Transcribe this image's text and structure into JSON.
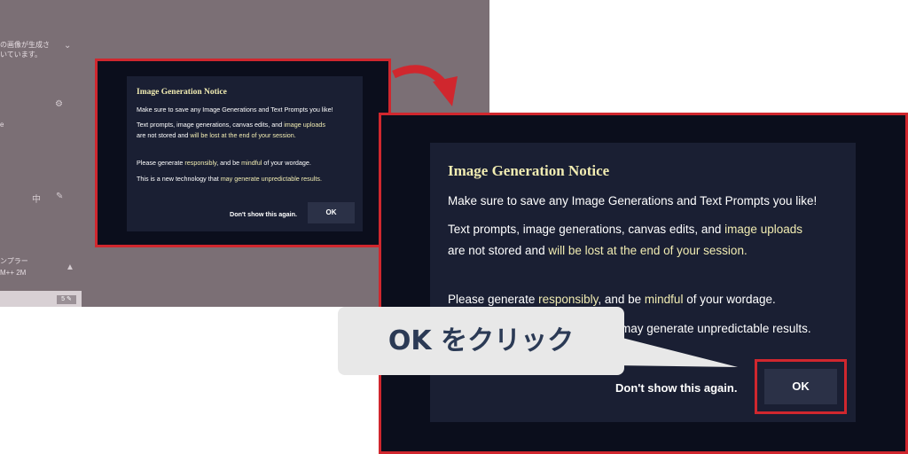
{
  "background_app": {
    "jp_text_line1": "の画像が生成さ",
    "jp_text_line2": "いています。",
    "sidebar_label": "e",
    "history_label": "ンプラー",
    "history_meta": "M++ 2M",
    "counter": "5 ✎"
  },
  "notice_small": {
    "title": "Image Generation Notice",
    "line1": "Make sure to save any Image Generations and Text Prompts you like!",
    "line2a": "Text prompts, image generations, canvas edits, and ",
    "line2b": "image uploads",
    "line3a": "are not stored and ",
    "line3b": "will be lost at the end of your session.",
    "line4a": "Please generate ",
    "line4b": "responsibly",
    "line4c": ", and be ",
    "line4d": "mindful",
    "line4e": " of your wordage.",
    "line5a": "This is a new technology that ",
    "line5b": "may generate unpredictable results.",
    "dont_show": "Don't show this again.",
    "ok_label": "OK"
  },
  "notice_large": {
    "title": "Image Generation Notice",
    "line1": "Make sure to save any Image Generations and Text Prompts you like!",
    "line2a": "Text prompts, image generations, canvas edits, and ",
    "line2b": "image uploads",
    "line3a": "are not stored and ",
    "line3b": "will be lost at the end of your session.",
    "line4a": "Please generate ",
    "line4b": "responsibly",
    "line4c": ", and be ",
    "line4d": "mindful",
    "line4e": " of your wordage.",
    "line5b": "may generate unpredictable results.",
    "dont_show": "Don't show this again.",
    "ok_label": "OK"
  },
  "callout": {
    "text": "OK をクリック"
  },
  "colors": {
    "highlight": "#d0272e",
    "accent_text": "#f1ecb2",
    "dialog_bg": "#1a1f33",
    "callout_text": "#2b3a55"
  }
}
